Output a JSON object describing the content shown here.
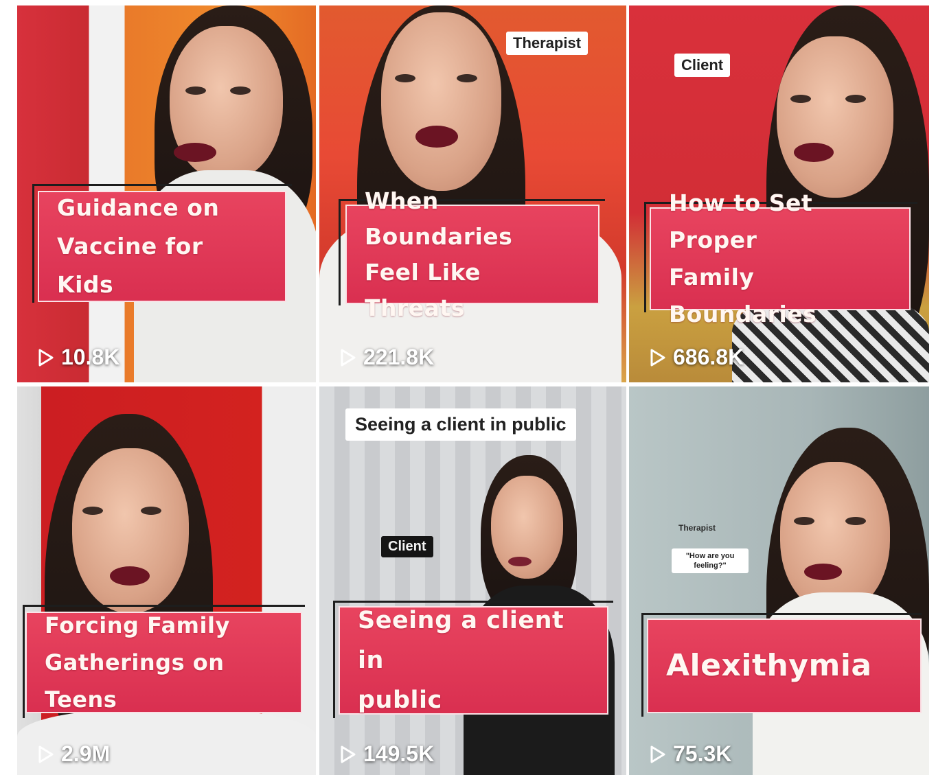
{
  "tiles": [
    {
      "title_line1": "Guidance on",
      "title_line2": "Vaccine for Kids",
      "views": "10.8K",
      "overlay": ""
    },
    {
      "title_line1": "When Boundaries",
      "title_line2": "Feel Like Threats",
      "views": "221.8K",
      "overlay": "Therapist"
    },
    {
      "title_line1": "How to Set Proper",
      "title_line2": "Family Boundaries",
      "views": "686.8K",
      "overlay": "Client"
    },
    {
      "title_line1": "Forcing Family",
      "title_line2": "Gatherings on Teens",
      "views": "2.9M",
      "overlay": ""
    },
    {
      "title_line1": "Seeing a client in",
      "title_line2": "public",
      "views": "149.5K",
      "overlay": "Seeing a client in public",
      "overlay2": "Client"
    },
    {
      "title_line1": "Alexithymia",
      "title_line2": "",
      "views": "75.3K",
      "overlay": "Therapist",
      "overlay2": "\"How are you feeling?\""
    }
  ],
  "icons": {
    "play": "play-icon"
  },
  "colors": {
    "card": "#e0395a",
    "text": "#ffffff"
  }
}
